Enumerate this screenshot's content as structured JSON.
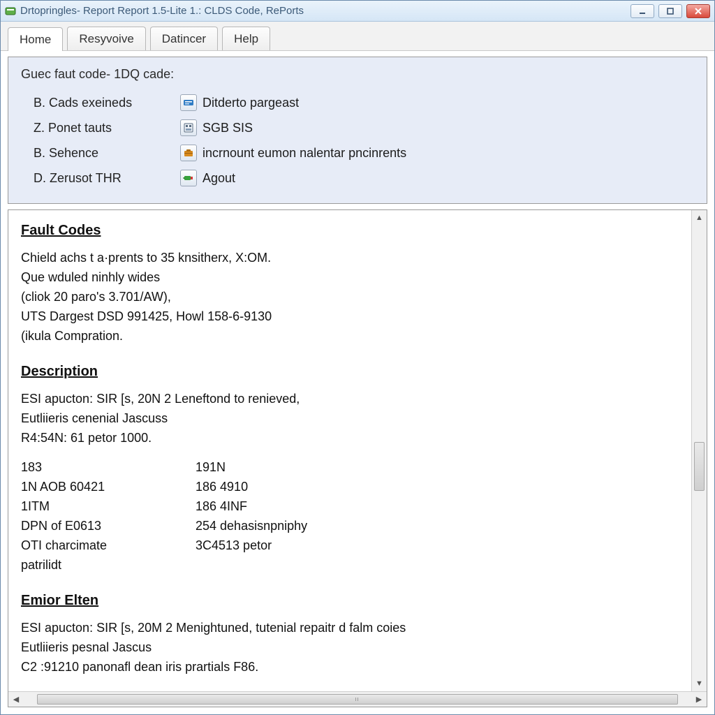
{
  "window": {
    "title": "Drtopringles- Report Report 1.5-Lite 1.: CLDS Code, RePorts"
  },
  "tabs": [
    {
      "label": "Home",
      "active": true
    },
    {
      "label": "Resyvoive",
      "active": false
    },
    {
      "label": "Datincer",
      "active": false
    },
    {
      "label": "Help",
      "active": false
    }
  ],
  "top_panel": {
    "legend": "Guec faut code- 1DQ cade:",
    "rows": [
      {
        "left": "B. Cads exeineds",
        "icon": "drive-icon",
        "icon_color": "#2f7cc4",
        "right": "Ditderto pargeast"
      },
      {
        "left": "Z. Ponet tauts",
        "icon": "module-icon",
        "icon_color": "#5a6c80",
        "right": "SGB SIS"
      },
      {
        "left": "B. Sehence",
        "icon": "case-icon",
        "icon_color": "#d88b1e",
        "right": "incrnount eumon nalentar pncinrents"
      },
      {
        "left": "D. Zerusot THR",
        "icon": "engine-icon",
        "icon_color": "#39a23c",
        "right": "Agout"
      }
    ]
  },
  "report": {
    "sections": {
      "fault_codes": {
        "heading": "Fault Codes",
        "lines": [
          "Chield achs t a·prents to 35 knsitherx, X:OM.",
          "Que wduled ninhly wides",
          "(cliok 20 paro's 3.701/AW),",
          "UTS Dargest DSD 991425, Howl 158-6-9130",
          "(ikula Compration."
        ]
      },
      "description": {
        "heading": "Description",
        "lines": [
          "ESI apucton: SIR [s, 20N 2 Leneftond to renieved,",
          "Eutliieris cenenial Jascuss",
          "R4:54N: 61 petor 1000."
        ],
        "table": [
          {
            "c1": "183",
            "c2": "191N"
          },
          {
            "c1": "1N AOB 60421",
            "c2": "186 4910"
          },
          {
            "c1": "1ITM",
            "c2": "186 4INF"
          },
          {
            "c1": "DPN of E0613",
            "c2": "254 dehasisnpniphy"
          },
          {
            "c1": "OTI charcimate",
            "c2": "3C4513 petor"
          },
          {
            "c1": "patrilidt",
            "c2": ""
          }
        ]
      },
      "emior": {
        "heading": "Emior Elten",
        "lines": [
          "ESI apucton: SIR [s, 20M 2 Menightuned, tutenial repaitr d falm coies",
          "Eutliieris pesnal Jascus",
          "C2 :91210 panonafl dean iris prartials F86."
        ]
      }
    }
  }
}
